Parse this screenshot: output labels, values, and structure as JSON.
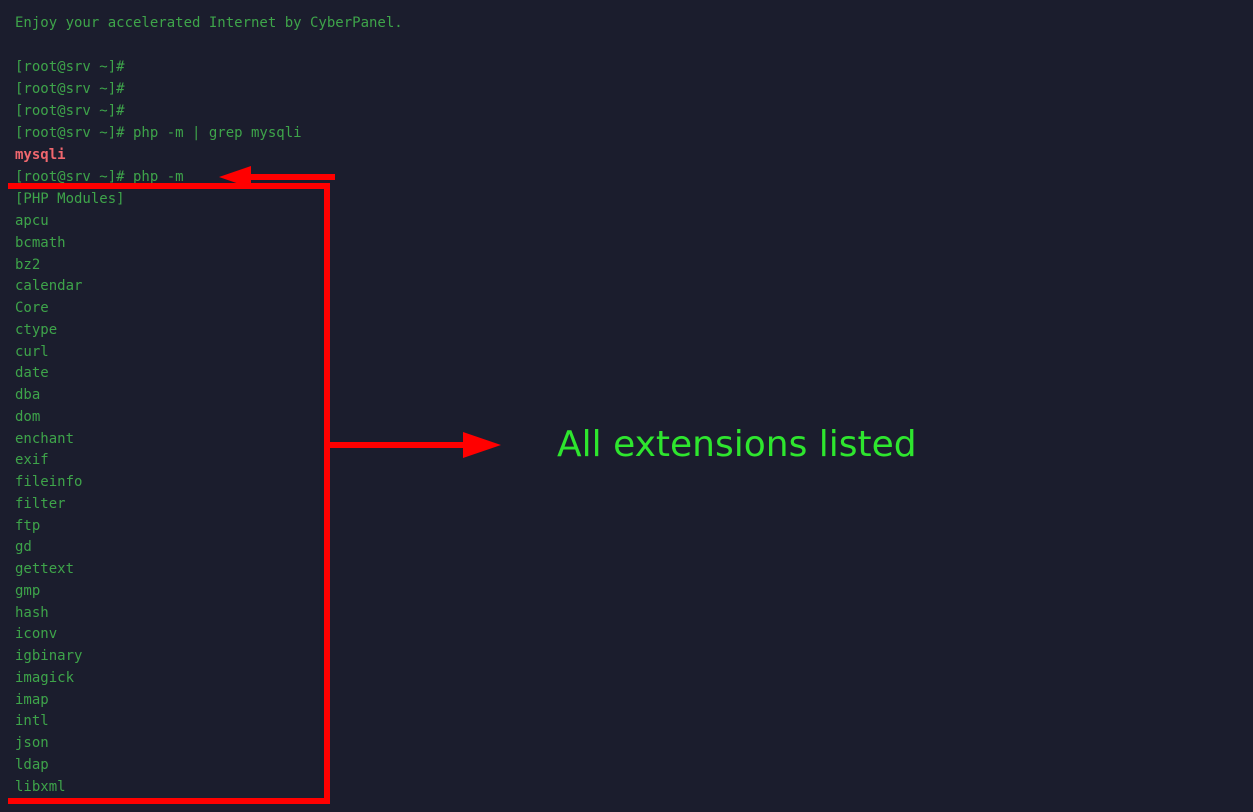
{
  "terminal": {
    "banner": "Enjoy your accelerated Internet by CyberPanel.",
    "prompts": [
      "[root@srv ~]#",
      "[root@srv ~]#",
      "[root@srv ~]#",
      "[root@srv ~]# php -m | grep mysqli"
    ],
    "grep_match": "mysqli",
    "command": "[root@srv ~]# php -m",
    "modules_header": "[PHP Modules]",
    "modules": [
      "apcu",
      "bcmath",
      "bz2",
      "calendar",
      "Core",
      "ctype",
      "curl",
      "date",
      "dba",
      "dom",
      "enchant",
      "exif",
      "fileinfo",
      "filter",
      "ftp",
      "gd",
      "gettext",
      "gmp",
      "hash",
      "iconv",
      "igbinary",
      "imagick",
      "imap",
      "intl",
      "json",
      "ldap",
      "libxml"
    ]
  },
  "annotation": {
    "label": "All extensions listed",
    "color": "#ff0000",
    "label_color": "#2ee62e"
  }
}
